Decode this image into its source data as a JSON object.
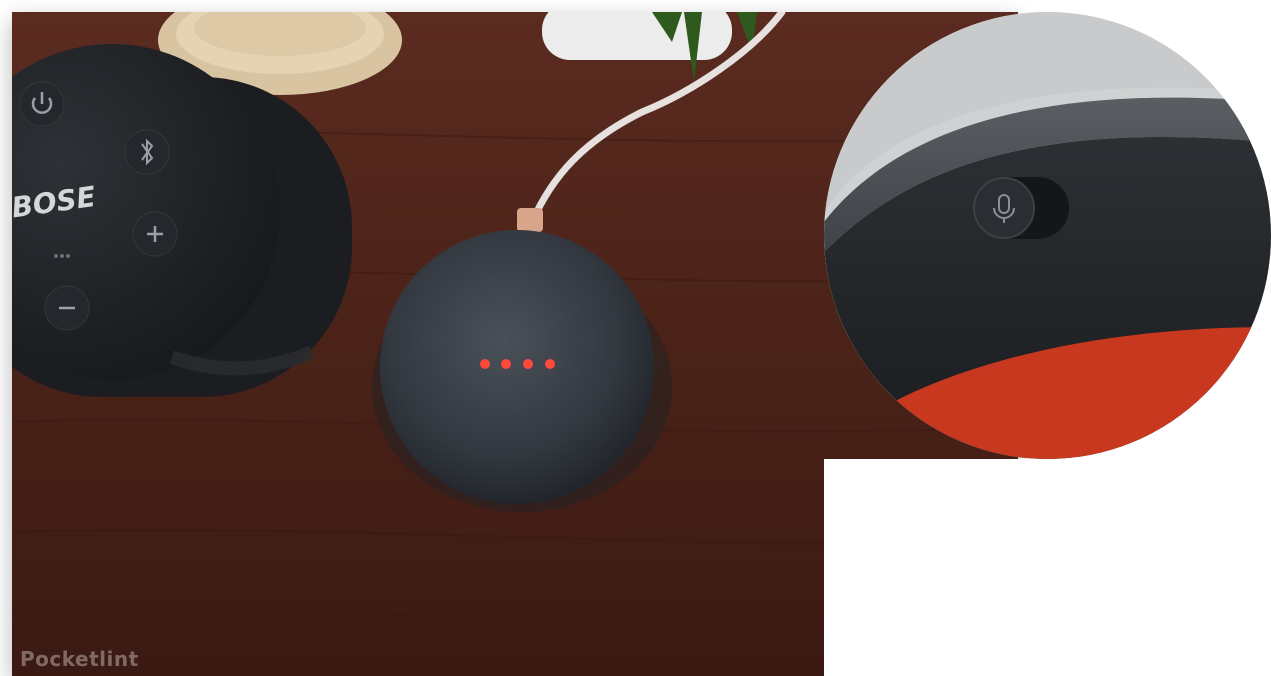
{
  "photo": {
    "speaker_brand": "BOSE",
    "watermark": "Pocketlint"
  },
  "colors": {
    "wood": "#4a2218",
    "speaker_fabric": "#3a3f47",
    "led": "#ff4a3a",
    "red_base": "#c8381f"
  },
  "icons": {
    "power": "power-icon",
    "bluetooth": "bluetooth-icon",
    "plus": "plus-icon",
    "minus": "minus-icon",
    "mic": "mic-icon"
  }
}
